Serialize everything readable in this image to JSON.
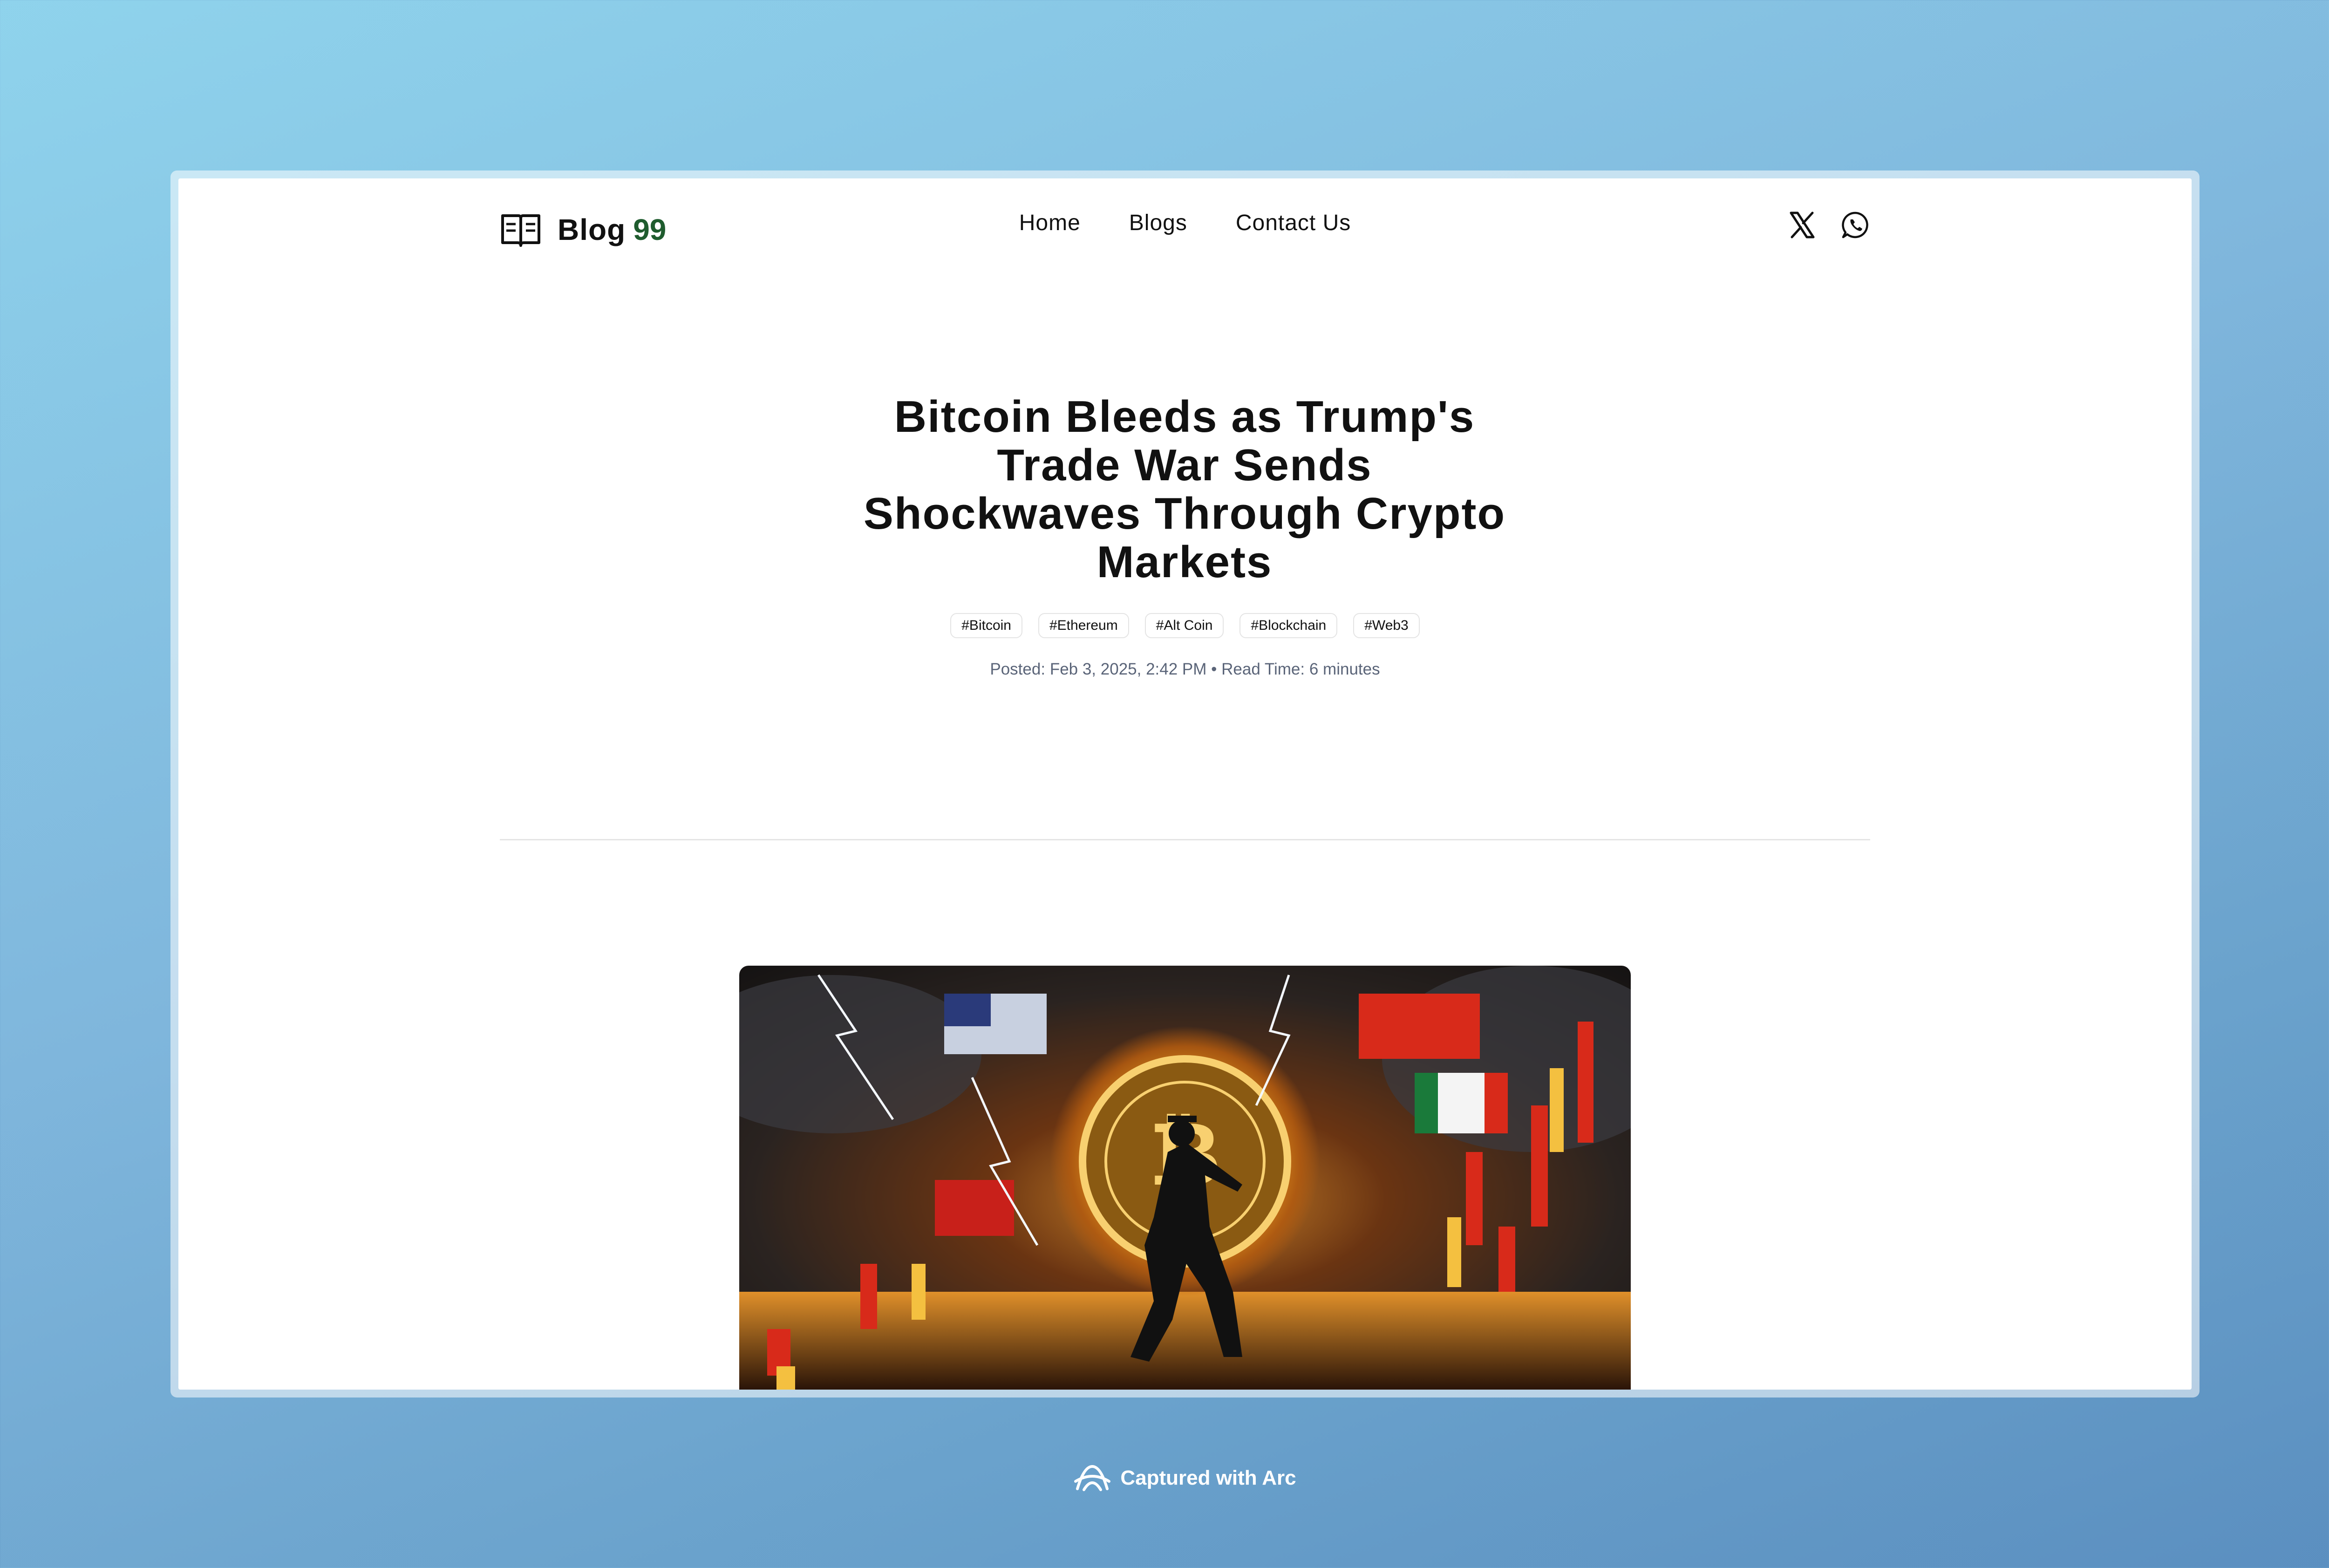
{
  "brand": {
    "name": "Blog",
    "number": "99",
    "accent_color": "#1f5c2e"
  },
  "nav": [
    {
      "label": "Home"
    },
    {
      "label": "Blogs"
    },
    {
      "label": "Contact Us"
    }
  ],
  "socials": [
    {
      "icon": "x-twitter-icon"
    },
    {
      "icon": "whatsapp-icon"
    }
  ],
  "article": {
    "title": "Bitcoin Bleeds as Trump's Trade War Sends Shockwaves Through Crypto Markets",
    "tags": [
      "#Bitcoin",
      "#Ethereum",
      "#Alt Coin",
      "#Blockchain",
      "#Web3"
    ],
    "posted_label": "Posted:",
    "posted_date": "Feb 3, 2025, 2:42 PM",
    "separator": "•",
    "read_time_label": "Read Time:",
    "read_time": "6 minutes",
    "hero_image": "bitcoin-trade-war-illustration"
  },
  "footer_caption": {
    "text": "Captured with Arc",
    "icon": "arc-logo-icon"
  }
}
